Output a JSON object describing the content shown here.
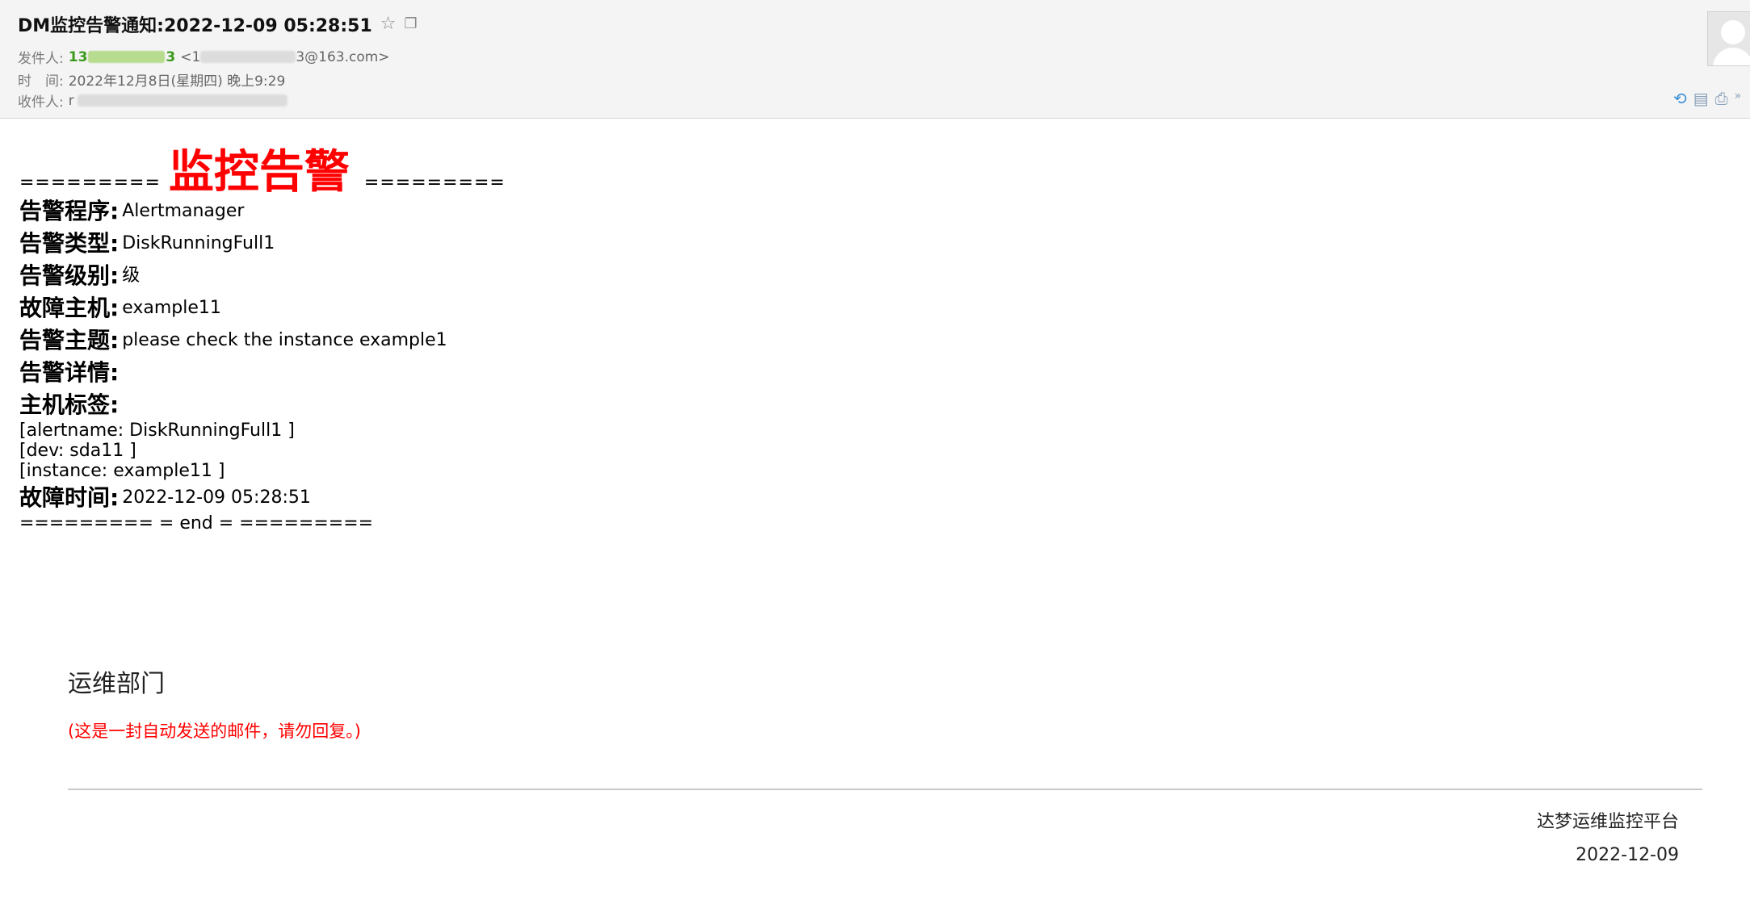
{
  "header": {
    "subject": "DM监控告警通知:2022-12-09 05:28:51",
    "sender_label": "发件人:",
    "sender_name_start": "13",
    "sender_name_end": "3",
    "sender_email_prefix": "<1",
    "sender_email_suffix": "3@163.com>",
    "time_label": "时　间:",
    "time_value": "2022年12月8日(星期四) 晚上9:29",
    "recipient_label": "收件人:",
    "recipient_start": "r",
    "icons": [
      "star-icon",
      "popout-icon",
      "avatar-placeholder",
      "reply-icon",
      "note-icon",
      "print-icon",
      "more-icon"
    ]
  },
  "body": {
    "title_left": "=========",
    "title": "监控告警",
    "title_right": "=========",
    "fields": [
      {
        "label": "告警程序:",
        "value": "Alertmanager"
      },
      {
        "label": "告警类型:",
        "value": "DiskRunningFull1"
      },
      {
        "label": "告警级别:",
        "value": "级"
      },
      {
        "label": "故障主机:",
        "value": "example11"
      },
      {
        "label": "告警主题:",
        "value": "please check the instance example1"
      },
      {
        "label": "告警详情:",
        "value": ""
      },
      {
        "label": "主机标签:",
        "value": ""
      }
    ],
    "tags": [
      "[alertname: DiskRunningFull1 ]",
      "[dev: sda11 ]",
      "[instance: example11 ]"
    ],
    "fault_time_label": "故障时间:",
    "fault_time_value": "2022-12-09 05:28:51",
    "end_line": "========= = end = ========="
  },
  "footer": {
    "department": "运维部门",
    "notice": "(这是一封自动发送的邮件，请勿回复。)",
    "platform": "达梦运维监控平台",
    "date": "2022-12-09"
  },
  "colors": {
    "alert_red": "#ff0000",
    "sender_green": "#3c9a1e",
    "header_bg": "#f4f4f4"
  }
}
